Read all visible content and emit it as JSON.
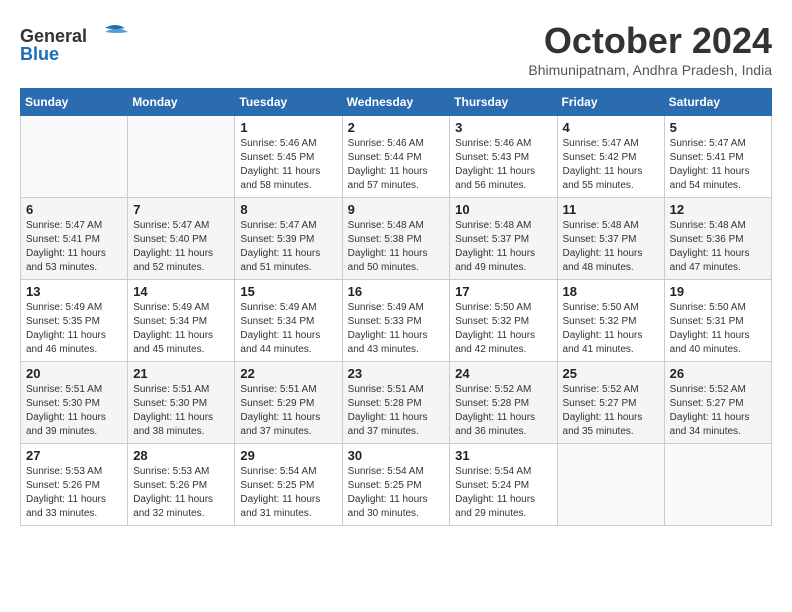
{
  "header": {
    "logo_general": "General",
    "logo_blue": "Blue",
    "month": "October 2024",
    "location": "Bhimunipatnam, Andhra Pradesh, India"
  },
  "weekdays": [
    "Sunday",
    "Monday",
    "Tuesday",
    "Wednesday",
    "Thursday",
    "Friday",
    "Saturday"
  ],
  "weeks": [
    [
      {
        "day": "",
        "info": ""
      },
      {
        "day": "",
        "info": ""
      },
      {
        "day": "1",
        "sunrise": "5:46 AM",
        "sunset": "5:45 PM",
        "daylight": "11 hours and 58 minutes."
      },
      {
        "day": "2",
        "sunrise": "5:46 AM",
        "sunset": "5:44 PM",
        "daylight": "11 hours and 57 minutes."
      },
      {
        "day": "3",
        "sunrise": "5:46 AM",
        "sunset": "5:43 PM",
        "daylight": "11 hours and 56 minutes."
      },
      {
        "day": "4",
        "sunrise": "5:47 AM",
        "sunset": "5:42 PM",
        "daylight": "11 hours and 55 minutes."
      },
      {
        "day": "5",
        "sunrise": "5:47 AM",
        "sunset": "5:41 PM",
        "daylight": "11 hours and 54 minutes."
      }
    ],
    [
      {
        "day": "6",
        "sunrise": "5:47 AM",
        "sunset": "5:41 PM",
        "daylight": "11 hours and 53 minutes."
      },
      {
        "day": "7",
        "sunrise": "5:47 AM",
        "sunset": "5:40 PM",
        "daylight": "11 hours and 52 minutes."
      },
      {
        "day": "8",
        "sunrise": "5:47 AM",
        "sunset": "5:39 PM",
        "daylight": "11 hours and 51 minutes."
      },
      {
        "day": "9",
        "sunrise": "5:48 AM",
        "sunset": "5:38 PM",
        "daylight": "11 hours and 50 minutes."
      },
      {
        "day": "10",
        "sunrise": "5:48 AM",
        "sunset": "5:37 PM",
        "daylight": "11 hours and 49 minutes."
      },
      {
        "day": "11",
        "sunrise": "5:48 AM",
        "sunset": "5:37 PM",
        "daylight": "11 hours and 48 minutes."
      },
      {
        "day": "12",
        "sunrise": "5:48 AM",
        "sunset": "5:36 PM",
        "daylight": "11 hours and 47 minutes."
      }
    ],
    [
      {
        "day": "13",
        "sunrise": "5:49 AM",
        "sunset": "5:35 PM",
        "daylight": "11 hours and 46 minutes."
      },
      {
        "day": "14",
        "sunrise": "5:49 AM",
        "sunset": "5:34 PM",
        "daylight": "11 hours and 45 minutes."
      },
      {
        "day": "15",
        "sunrise": "5:49 AM",
        "sunset": "5:34 PM",
        "daylight": "11 hours and 44 minutes."
      },
      {
        "day": "16",
        "sunrise": "5:49 AM",
        "sunset": "5:33 PM",
        "daylight": "11 hours and 43 minutes."
      },
      {
        "day": "17",
        "sunrise": "5:50 AM",
        "sunset": "5:32 PM",
        "daylight": "11 hours and 42 minutes."
      },
      {
        "day": "18",
        "sunrise": "5:50 AM",
        "sunset": "5:32 PM",
        "daylight": "11 hours and 41 minutes."
      },
      {
        "day": "19",
        "sunrise": "5:50 AM",
        "sunset": "5:31 PM",
        "daylight": "11 hours and 40 minutes."
      }
    ],
    [
      {
        "day": "20",
        "sunrise": "5:51 AM",
        "sunset": "5:30 PM",
        "daylight": "11 hours and 39 minutes."
      },
      {
        "day": "21",
        "sunrise": "5:51 AM",
        "sunset": "5:30 PM",
        "daylight": "11 hours and 38 minutes."
      },
      {
        "day": "22",
        "sunrise": "5:51 AM",
        "sunset": "5:29 PM",
        "daylight": "11 hours and 37 minutes."
      },
      {
        "day": "23",
        "sunrise": "5:51 AM",
        "sunset": "5:28 PM",
        "daylight": "11 hours and 37 minutes."
      },
      {
        "day": "24",
        "sunrise": "5:52 AM",
        "sunset": "5:28 PM",
        "daylight": "11 hours and 36 minutes."
      },
      {
        "day": "25",
        "sunrise": "5:52 AM",
        "sunset": "5:27 PM",
        "daylight": "11 hours and 35 minutes."
      },
      {
        "day": "26",
        "sunrise": "5:52 AM",
        "sunset": "5:27 PM",
        "daylight": "11 hours and 34 minutes."
      }
    ],
    [
      {
        "day": "27",
        "sunrise": "5:53 AM",
        "sunset": "5:26 PM",
        "daylight": "11 hours and 33 minutes."
      },
      {
        "day": "28",
        "sunrise": "5:53 AM",
        "sunset": "5:26 PM",
        "daylight": "11 hours and 32 minutes."
      },
      {
        "day": "29",
        "sunrise": "5:54 AM",
        "sunset": "5:25 PM",
        "daylight": "11 hours and 31 minutes."
      },
      {
        "day": "30",
        "sunrise": "5:54 AM",
        "sunset": "5:25 PM",
        "daylight": "11 hours and 30 minutes."
      },
      {
        "day": "31",
        "sunrise": "5:54 AM",
        "sunset": "5:24 PM",
        "daylight": "11 hours and 29 minutes."
      },
      {
        "day": "",
        "info": ""
      },
      {
        "day": "",
        "info": ""
      }
    ]
  ]
}
